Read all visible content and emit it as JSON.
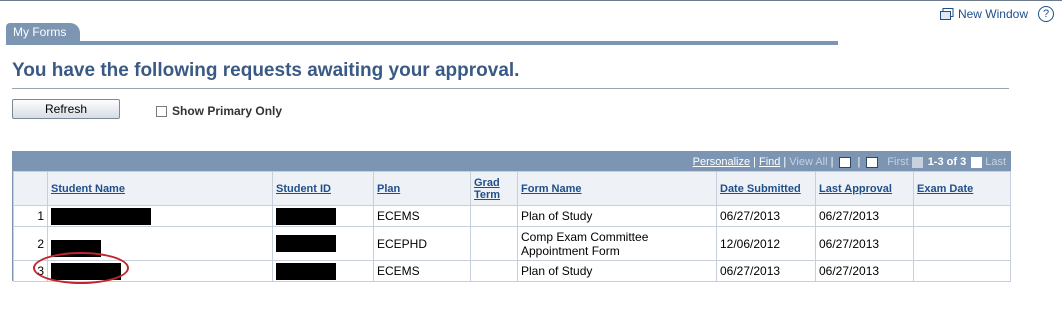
{
  "header": {
    "new_window_label": "New Window",
    "help_icon": "?"
  },
  "tab": {
    "label": "My Forms"
  },
  "page": {
    "title": "You have the following requests awaiting your approval."
  },
  "controls": {
    "refresh_label": "Refresh",
    "show_primary_label": "Show Primary Only",
    "show_primary_checked": false
  },
  "grid": {
    "nav": {
      "personalize": "Personalize",
      "find": "Find",
      "view_all": "View All",
      "first": "First",
      "range": "1-3 of 3",
      "last": "Last"
    },
    "columns": [
      "",
      "Student Name",
      "Student ID",
      "Plan",
      "Grad Term",
      "Form Name",
      "Date Submitted",
      "Last Approval",
      "Exam Date"
    ],
    "rows": [
      {
        "num": "1",
        "plan": "ECEMS",
        "grad_term": "",
        "form_name": "Plan of Study",
        "date_submitted": "06/27/2013",
        "last_approval": "06/27/2013",
        "exam_date": ""
      },
      {
        "num": "2",
        "plan": "ECEPHD",
        "grad_term": "",
        "form_name": "Comp Exam Committee Appointment Form",
        "date_submitted": "12/06/2012",
        "last_approval": "06/27/2013",
        "exam_date": ""
      },
      {
        "num": "3",
        "plan": "ECEMS",
        "grad_term": "",
        "form_name": "Plan of Study",
        "date_submitted": "06/27/2013",
        "last_approval": "06/27/2013",
        "exam_date": ""
      }
    ]
  },
  "colors": {
    "accent": "#7b95b3",
    "link": "#1f4f8a",
    "title": "#3a5a85",
    "annotation": "#c0262d"
  }
}
